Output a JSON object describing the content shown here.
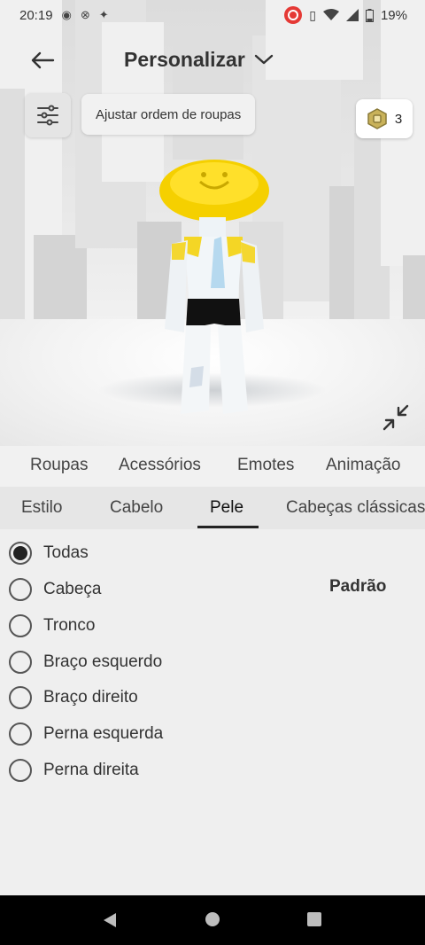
{
  "status_bar": {
    "time": "20:19",
    "battery": "19%",
    "icons": [
      "media-icon",
      "link-icon",
      "bug-icon",
      "record-icon",
      "vibrate-icon",
      "wifi-icon",
      "signal-icon",
      "battery-icon"
    ]
  },
  "header": {
    "title": "Personalizar",
    "back_icon": "arrow-left-icon",
    "dropdown_icon": "chevron-down-icon"
  },
  "toolbar": {
    "adjust_icon": "sliders-icon",
    "adjust_tooltip": "Ajustar ordem de roupas"
  },
  "robux": {
    "icon": "robux-icon",
    "balance": "3"
  },
  "category_tabs": [
    "Roupas",
    "Acessórios",
    "Emotes",
    "Animação"
  ],
  "sub_tabs": [
    "Estilo",
    "Cabelo",
    "Pele",
    "Cabeças clássicas"
  ],
  "active_sub_tab": "Pele",
  "body_parts": [
    {
      "label": "Todas",
      "checked": true
    },
    {
      "label": "Cabeça",
      "checked": false
    },
    {
      "label": "Tronco",
      "checked": false
    },
    {
      "label": "Braço esquerdo",
      "checked": false
    },
    {
      "label": "Braço direito",
      "checked": false
    },
    {
      "label": "Perna esquerda",
      "checked": false
    },
    {
      "label": "Perna direita",
      "checked": false
    }
  ],
  "skin_tone_label": "Padrão",
  "colors": {
    "accent": "#222222",
    "hat_yellow": "#f5d000",
    "record_red": "#e53935"
  }
}
